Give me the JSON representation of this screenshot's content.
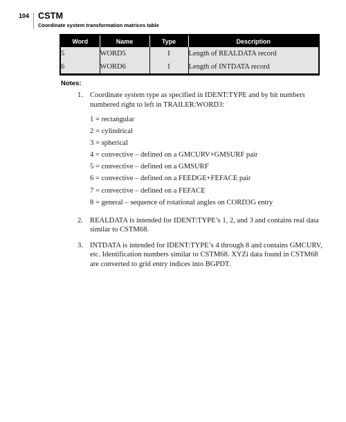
{
  "header": {
    "folio": "104",
    "title": "CSTM",
    "subtitle": "Coordinate system transformation matrices table",
    "rule_color": "#9a9a9a"
  },
  "table": {
    "columns": [
      "Word",
      "Name",
      "Type",
      "Description"
    ],
    "header_bg": "#000000",
    "header_fg": "#ffffff",
    "row_bg": "#e4e4e4",
    "rows": [
      {
        "word": "5",
        "name": "WORD5",
        "type": "I",
        "description": "Length of REALDATA record"
      },
      {
        "word": "6",
        "name": "WORD6",
        "type": "I",
        "description": "Length of INTDATA record"
      }
    ]
  },
  "notes": {
    "heading": "Notes:",
    "items": [
      {
        "number": "1.",
        "text": "Coordinate system type as specified in IDENT:TYPE and by bit numbers numbered right to left in TRAILER:WORD3:",
        "type_list": [
          "1 = rectangular",
          "2 = cylindrical",
          "3 = spherical",
          "4 = convective – defined on a GMCURV+GMSURF pair",
          "5 = convective – defined on a GMSURF",
          "6 = convective – defined on a FEEDGE+FEFACE pair",
          "7 = convective – defined on a FEFACE",
          "8 = general – sequence of rotational angles on CORD3G entry"
        ]
      },
      {
        "number": "2.",
        "text": "REALDATA is intended for IDENT:TYPE’s 1, 2, and 3 and contains real data similar to CSTM68.",
        "type_list": []
      },
      {
        "number": "3.",
        "text": "INTDATA is intended for IDENT:TYPE’s 4 through 8 and contains GMCURV, etc. Identification numbers similar to CSTM68. XYZi data found in CSTM68 are converted to grid entry indices into BGPDT.",
        "type_list": []
      }
    ]
  }
}
